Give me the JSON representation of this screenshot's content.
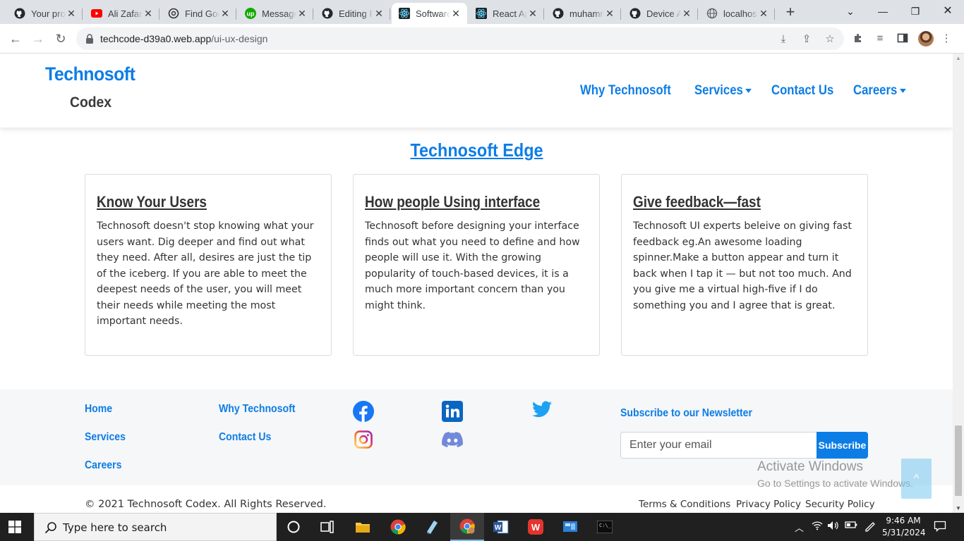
{
  "browser": {
    "tabs": [
      {
        "title": "Your profile",
        "icon": "github-icon"
      },
      {
        "title": "Ali Zafar",
        "icon": "youtube-icon"
      },
      {
        "title": "Find Google",
        "icon": "chatgpt-icon"
      },
      {
        "title": "Messages",
        "icon": "upwork-icon"
      },
      {
        "title": "Editing README",
        "icon": "github-icon"
      },
      {
        "title": "Software",
        "icon": "react-icon",
        "active": true
      },
      {
        "title": "React App",
        "icon": "react-icon"
      },
      {
        "title": "muhammad",
        "icon": "github-icon"
      },
      {
        "title": "Device Activity",
        "icon": "github-icon"
      },
      {
        "title": "localhost",
        "icon": "globe-icon"
      }
    ],
    "url_host": "techcode-d39a0.web.app",
    "url_path": "/ui-ux-design"
  },
  "site": {
    "brand_line1": "Technosoft",
    "brand_line2": "Codex",
    "nav": {
      "why": "Why Technosoft",
      "services": "Services",
      "contact": "Contact Us",
      "careers": "Careers"
    },
    "section_title": "Technosoft Edge",
    "cards": [
      {
        "title": "Know Your Users",
        "body": "Technosoft doesn't stop knowing what your users want. Dig deeper and find out what they need. After all, desires are just the tip of the iceberg. If you are able to meet the deepest needs of the user, you will meet their needs while meeting the most important needs."
      },
      {
        "title": "How people Using interface",
        "body": "Technosoft before designing your interface finds out what you need to define and how people will use it. With the growing popularity of touch-based devices, it is a much more important concern than you might think."
      },
      {
        "title": "Give feedback—fast",
        "body": "Technosoft UI experts beleive on giving fast feedback eg.An awesome loading spinner.Make a button appear and turn it back when I tap it — but not too much. And you give me a virtual high-five if I do something you and I agree that is great."
      }
    ],
    "footer": {
      "links": {
        "home": "Home",
        "services": "Services",
        "careers": "Careers",
        "why": "Why Technosoft",
        "contact": "Contact Us"
      },
      "social": [
        "facebook-icon",
        "linkedin-icon",
        "twitter-icon",
        "instagram-icon",
        "discord-icon"
      ],
      "newsletter_title": "Subscribe to our Newsletter",
      "email_placeholder": "Enter your email",
      "subscribe_label": "Subscribe",
      "copyright": "© 2021 Technosoft Codex. All Rights Reserved.",
      "terms": "Terms & Conditions",
      "privacy": "Privacy Policy",
      "security": "Security Policy",
      "to_top": "^"
    },
    "watermark_line1": "Activate Windows",
    "watermark_line2": "Go to Settings to activate Windows."
  },
  "taskbar": {
    "search_placeholder": "Type here to search",
    "time": "9:46 AM",
    "date": "5/31/2024"
  },
  "colors": {
    "accent": "#0d7de6",
    "tab_strip": "#dee1e6",
    "taskbar": "#202020"
  }
}
